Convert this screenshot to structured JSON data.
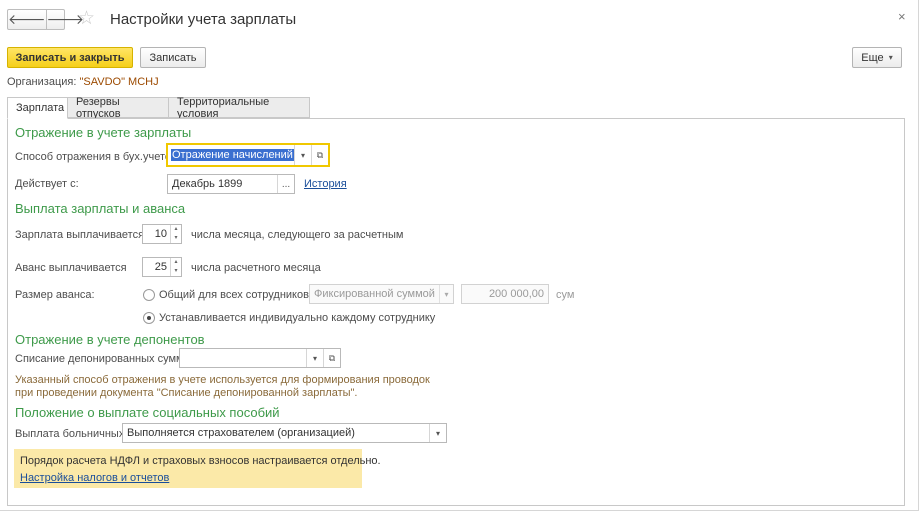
{
  "header": {
    "back_icon": "arrow-left-icon",
    "forward_icon": "arrow-right-icon",
    "back_glyph": "🡐",
    "forward_glyph": "🡒",
    "favorite_glyph": "☆",
    "close_glyph": "×",
    "title": "Настройки учета зарплаты"
  },
  "toolbar": {
    "save_close_label": "Записать и закрыть",
    "save_label": "Записать",
    "more_label": "Еще",
    "more_caret": "▾"
  },
  "organization": {
    "label": "Организация:",
    "value": "\"SAVDO\" MCHJ"
  },
  "tabs": [
    {
      "label": "Зарплата",
      "active": true
    },
    {
      "label": "Резервы отпусков",
      "active": false
    },
    {
      "label": "Территориальные условия",
      "active": false
    }
  ],
  "salary_accounting": {
    "heading": "Отражение в учете зарплаты",
    "method_label": "Способ отражения в бух.учете:",
    "method_value": "Отражение начислений по",
    "effective_label": "Действует с:",
    "effective_value": "Декабрь 1899",
    "history_link": "История",
    "dropdown_glyph": "▾",
    "open_glyph": "⧉",
    "ellipsis_glyph": "..."
  },
  "payment": {
    "heading": "Выплата зарплаты и аванса",
    "salary_label": "Зарплата выплачивается",
    "salary_day": "10",
    "salary_suffix": "числа месяца, следующего за расчетным",
    "advance_label": "Аванс выплачивается",
    "advance_day": "25",
    "advance_suffix": "числа расчетного месяца",
    "advance_size_label": "Размер аванса:",
    "option_common": "Общий для всех сотрудников",
    "advance_type_value": "Фиксированной суммой",
    "advance_amount": "200 000,00",
    "currency": "сум",
    "option_individual": "Устанавливается индивидуально каждому сотруднику",
    "selected_option": "individual"
  },
  "deponents": {
    "heading": "Отражение в учете депонентов",
    "writeoff_label": "Списание депонированных сумм:",
    "writeoff_value": "",
    "hint_line1": "Указанный способ отражения в учете используется для формирования проводок",
    "hint_line2": "при проведении документа \"Списание депонированной зарплаты\"."
  },
  "benefits": {
    "heading": "Положение о выплате социальных пособий",
    "sick_label": "Выплата больничных:",
    "sick_value": "Выполняется страхователем (организацией)"
  },
  "note": {
    "text": "Порядок расчета НДФЛ и страховых взносов настраивается отдельно.",
    "link": "Настройка налогов и отчетов"
  },
  "colors": {
    "accent_green": "#3e9a4a",
    "primary_yellow": "#f5cf1a",
    "link_blue": "#1a4e9a",
    "note_bg": "#fbe9a8"
  }
}
